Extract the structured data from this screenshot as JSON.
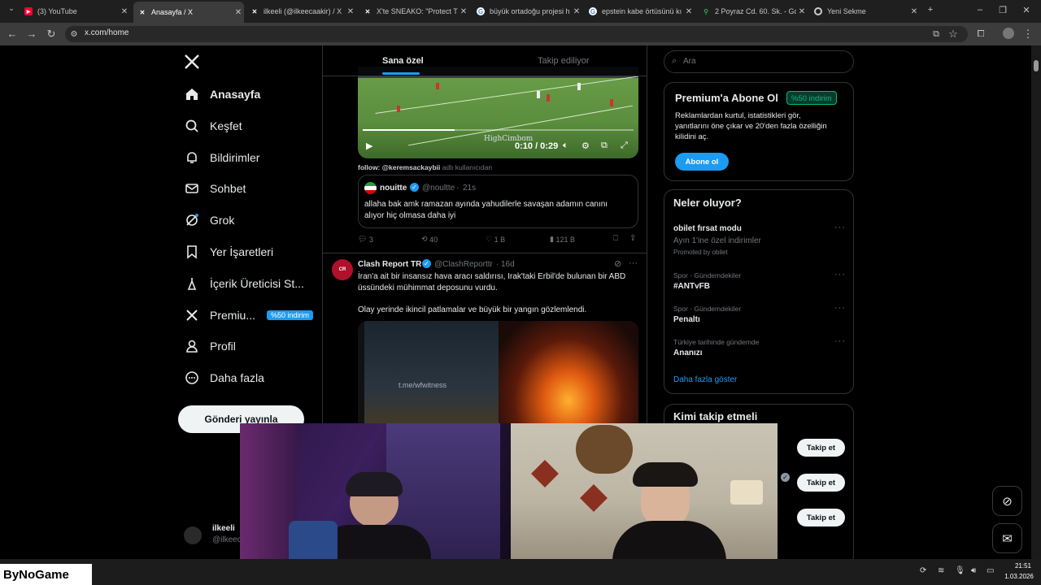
{
  "browser": {
    "tabs": [
      {
        "title": "(3) YouTube",
        "favicon": "youtube-icon",
        "color": "#ff0033"
      },
      {
        "title": "Anasayfa / X",
        "favicon": "x-icon",
        "color": "#ffffff",
        "active": true
      },
      {
        "title": "ilkeeli (@ilkeecaakir) / X",
        "favicon": "x-icon",
        "color": "#ffffff"
      },
      {
        "title": "X'te SNEAKO: \"Protect Tu",
        "favicon": "x-icon",
        "color": "#ffffff"
      },
      {
        "title": "büyük ortadoğu projesi h",
        "favicon": "google-icon",
        "color": "#ffffff"
      },
      {
        "title": "epstein kabe örtüsünü kı",
        "favicon": "google-icon",
        "color": "#ffffff"
      },
      {
        "title": "2 Poyraz Cd. 60. Sk. - Goo",
        "favicon": "maps-icon",
        "color": "#34a853"
      },
      {
        "title": "Yeni Sekme",
        "favicon": "chrome-icon",
        "color": "#ffffff"
      }
    ],
    "url": "x.com/home"
  },
  "leftnav": {
    "items": [
      {
        "label": "Anasayfa",
        "icon": "home-icon",
        "bold": true
      },
      {
        "label": "Keşfet",
        "icon": "search-icon"
      },
      {
        "label": "Bildirimler",
        "icon": "bell-icon"
      },
      {
        "label": "Sohbet",
        "icon": "mail-icon"
      },
      {
        "label": "Grok",
        "icon": "grok-icon"
      },
      {
        "label": "Yer İşaretleri",
        "icon": "bookmark-icon"
      },
      {
        "label": "İçerik Üreticisi St...",
        "icon": "creator-icon"
      },
      {
        "label": "Premiu...",
        "icon": "x-icon",
        "badge": "%50 indirim"
      },
      {
        "label": "Profil",
        "icon": "profile-icon"
      },
      {
        "label": "Daha fazla",
        "icon": "more-icon"
      }
    ],
    "post_button": "Gönderi yayınla",
    "account": {
      "name": "ilkeeli",
      "handle": "@ilkeec"
    }
  },
  "feed": {
    "tabs": [
      "Sana özel",
      "Takip ediliyor"
    ],
    "video": {
      "time": "0:10 / 0:29",
      "watermark": "HighCimbom",
      "progress": 0.34
    },
    "follow_note": {
      "handle": "follow: @keremsackaybii",
      "suffix": "adlı kullanıcıdan"
    },
    "quoted": {
      "name": "nouitte",
      "handle": "@noultte",
      "age": "21s",
      "text": "allaha bak amk ramazan ayında yahudilerle savaşan adamın canını alıyor hiç olmasa daha iyi"
    },
    "stats1": {
      "replies": "3",
      "reposts": "40",
      "likes": "1 B",
      "views": "121 B"
    },
    "post2": {
      "name": "Clash Report TR",
      "handle": "@ClashReporttr",
      "age": "16d",
      "line1": "İran'a ait bir insansız hava aracı saldırısı, Irak'taki Erbil'de bulunan bir ABD",
      "line2": "üssündeki mühimmat deposunu vurdu.",
      "line3": "Olay yerinde ikincil patlamalar ve büyük bir yangın gözlemlendi.",
      "image_watermark": "t.me/wfwitness"
    }
  },
  "right": {
    "search_placeholder": "Ara",
    "premium": {
      "title": "Premium'a Abone Ol",
      "badge": "%50 indirim",
      "text1": "Reklamlardan kurtul, istatistikleri gör,",
      "text2": "yanıtlarını öne çıkar ve 20'den fazla özelliğin",
      "text3": "kilidini aç.",
      "button": "Abone ol"
    },
    "trends": {
      "title": "Neler oluyor?",
      "items": [
        {
          "meta": "",
          "name": "obilet fırsat modu",
          "sub": "Ayın 1'ine özel indirimler",
          "promo": "Promoted by obilet"
        },
        {
          "meta": "Spor · Gündemdekiler",
          "name": "#ANTvFB"
        },
        {
          "meta": "Spor · Gündemdekiler",
          "name": "Penaltı"
        },
        {
          "meta": "Türkiye tarihinde gündemde",
          "name": "Ananızı"
        }
      ],
      "more": "Daha fazla göster"
    },
    "who_to_follow": {
      "title": "Kimi takip etmeli",
      "button": "Takip et"
    }
  },
  "taskbar": {
    "brand": "ByNoGame",
    "time": "21:51",
    "date": "1.03.2026"
  },
  "colors": {
    "accent": "#1d9bf0",
    "premium_badge": "#00ba7c",
    "border": "#2f3336"
  }
}
